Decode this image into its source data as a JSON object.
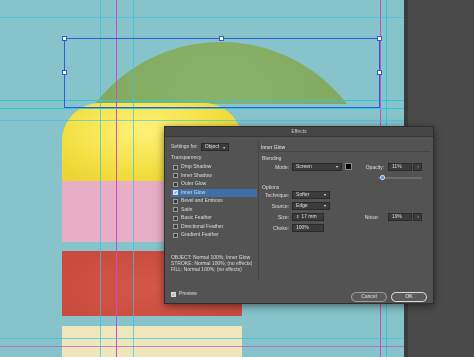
{
  "dialog": {
    "title": "Effects",
    "settings_for_label": "Settings for:",
    "settings_for_value": "Object",
    "effects_header": "Transparency",
    "effects": [
      {
        "label": "Drop Shadow",
        "checked": false,
        "active": false
      },
      {
        "label": "Inner Shadow",
        "checked": false,
        "active": false
      },
      {
        "label": "Outer Glow",
        "checked": false,
        "active": false
      },
      {
        "label": "Inner Glow",
        "checked": true,
        "active": true
      },
      {
        "label": "Bevel and Emboss",
        "checked": false,
        "active": false
      },
      {
        "label": "Satin",
        "checked": false,
        "active": false
      },
      {
        "label": "Basic Feather",
        "checked": false,
        "active": false
      },
      {
        "label": "Directional Feather",
        "checked": false,
        "active": false
      },
      {
        "label": "Gradient Feather",
        "checked": false,
        "active": false
      }
    ],
    "summary_lines": [
      "OBJECT: Normal 100%; Inner Glow",
      "STROKE: Normal 100%; (no effects)",
      "FILL: Normal 100%; (no effects)"
    ],
    "preview_label": "Preview",
    "preview_checked": true,
    "panel_title": "Inner Glow",
    "blending": {
      "group_label": "Blending",
      "mode_label": "Mode:",
      "mode_value": "Screen",
      "swatch_color": "#000000",
      "opacity_label": "Opacity:",
      "opacity_value": "11%",
      "opacity_level": 0.11
    },
    "options": {
      "group_label": "Options",
      "technique_label": "Technique:",
      "technique_value": "Softer",
      "source_label": "Source:",
      "source_value": "Edge",
      "size_label": "Size:",
      "size_value": "17 mm",
      "noise_label": "Noise:",
      "noise_value": "19%",
      "choke_label": "Choke:",
      "choke_value": "100%"
    },
    "cancel_label": "Cancel",
    "ok_label": "OK"
  },
  "colors": {
    "canvas_bg": "#86c3ca",
    "arch_green": "#7ba55a",
    "band_yellow": "#f3de3f",
    "band_pink": "#e8aec6",
    "band_red": "#c94b3e",
    "band_cream": "#eee6bc",
    "pasteboard": "#4b4b4b",
    "guide_magenta": "#c64fc8",
    "guide_cyan": "#33c4de",
    "selection_blue": "#2f5bd8",
    "dialog_bg": "#535353",
    "active_item": "#3d6fa8"
  }
}
